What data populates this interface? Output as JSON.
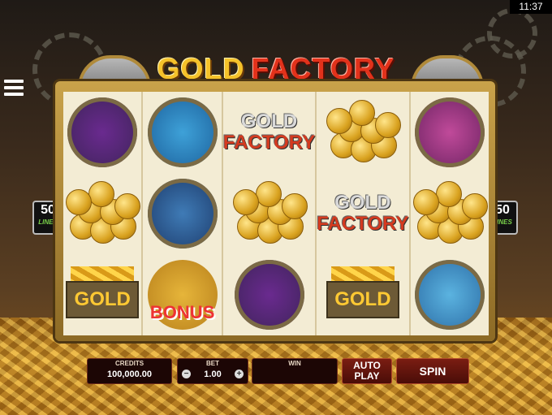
{
  "clock": "11:37",
  "game": {
    "title_part1": "GOLD",
    "title_part2": "FACTORY"
  },
  "lines_label": {
    "count": "50",
    "word": "LINES"
  },
  "reels": [
    [
      "ringmaster",
      "coins",
      "gold-cart"
    ],
    [
      "submarine",
      "train",
      "bonus"
    ],
    [
      "logo",
      "coins",
      "ringmaster"
    ],
    [
      "coins",
      "logo",
      "gold-cart"
    ],
    [
      "boy-character",
      "coins",
      "airship"
    ]
  ],
  "symbol_text": {
    "cart": "GOLD",
    "bonus": "BONUS",
    "logo_top": "GOLD",
    "logo_bottom": "FACTORY"
  },
  "controls": {
    "credits_label": "CREDITS",
    "credits_value": "100,000.00",
    "bet_label": "BET",
    "bet_value": "1.00",
    "bet_minus": "−",
    "bet_plus": "+",
    "win_label": "WIN",
    "win_value": "",
    "autoplay_line1": "AUTO",
    "autoplay_line2": "PLAY",
    "spin_label": "SPIN"
  }
}
